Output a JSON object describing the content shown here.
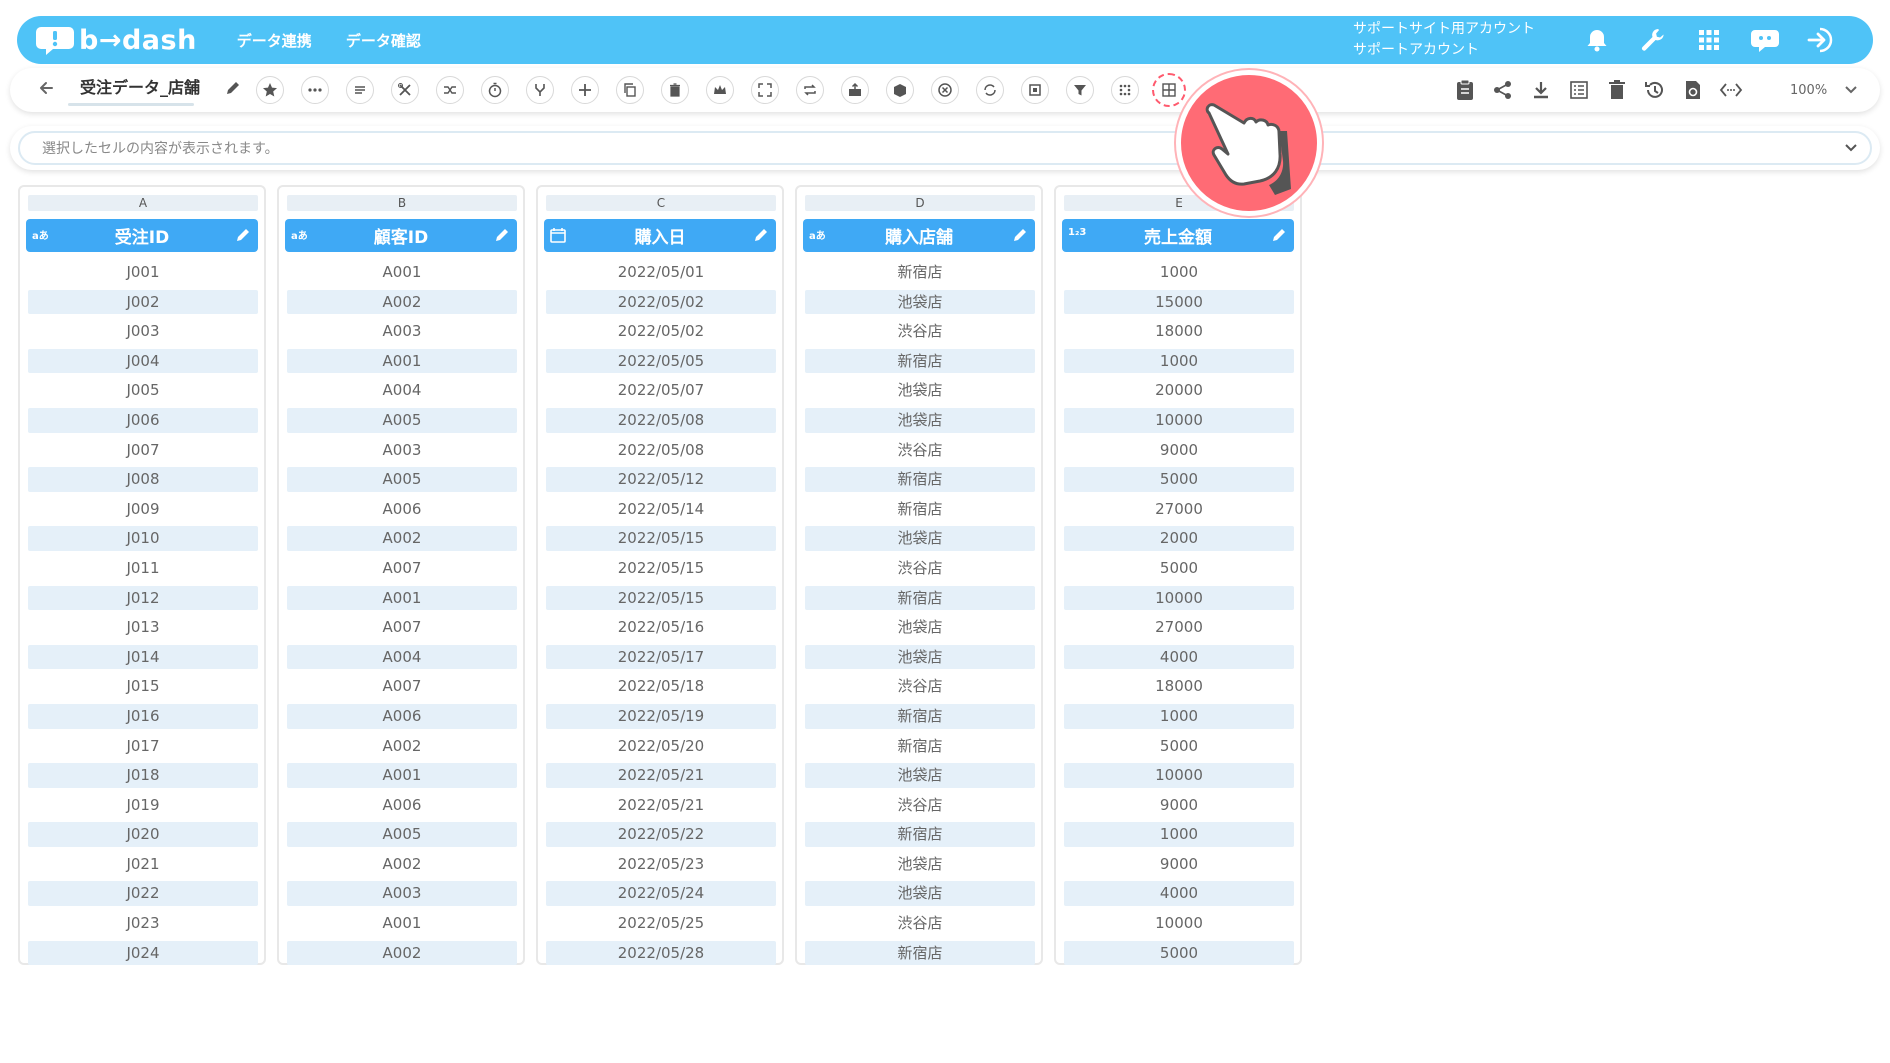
{
  "app": {
    "logo_text": "b→dash",
    "nav": [
      "データ連携",
      "データ確認"
    ],
    "account_line1": "サポートサイト用アカウント",
    "account_line2": "サポートアカウント",
    "brand_color": "#4fc3f7",
    "header_color": "#3fa9f5",
    "highlight_color": "#ff6b75"
  },
  "toolbar": {
    "title": "受注データ_店舗",
    "zoom": "100%"
  },
  "cellbar": {
    "placeholder": "選択したセルの内容が表示されます。"
  },
  "table": {
    "columns": [
      {
        "letter": "A",
        "name": "受注ID",
        "type_badge": "aあ",
        "values": [
          "J001",
          "J002",
          "J003",
          "J004",
          "J005",
          "J006",
          "J007",
          "J008",
          "J009",
          "J010",
          "J011",
          "J012",
          "J013",
          "J014",
          "J015",
          "J016",
          "J017",
          "J018",
          "J019",
          "J020",
          "J021",
          "J022",
          "J023",
          "J024"
        ]
      },
      {
        "letter": "B",
        "name": "顧客ID",
        "type_badge": "aあ",
        "values": [
          "A001",
          "A002",
          "A003",
          "A001",
          "A004",
          "A005",
          "A003",
          "A005",
          "A006",
          "A002",
          "A007",
          "A001",
          "A007",
          "A004",
          "A007",
          "A006",
          "A002",
          "A001",
          "A006",
          "A005",
          "A002",
          "A003",
          "A001",
          "A002"
        ]
      },
      {
        "letter": "C",
        "name": "購入日",
        "type_badge": "calendar",
        "values": [
          "2022/05/01",
          "2022/05/02",
          "2022/05/02",
          "2022/05/05",
          "2022/05/07",
          "2022/05/08",
          "2022/05/08",
          "2022/05/12",
          "2022/05/14",
          "2022/05/15",
          "2022/05/15",
          "2022/05/15",
          "2022/05/16",
          "2022/05/17",
          "2022/05/18",
          "2022/05/19",
          "2022/05/20",
          "2022/05/21",
          "2022/05/21",
          "2022/05/22",
          "2022/05/23",
          "2022/05/24",
          "2022/05/25",
          "2022/05/28"
        ]
      },
      {
        "letter": "D",
        "name": "購入店舗",
        "type_badge": "aあ",
        "values": [
          "新宿店",
          "池袋店",
          "渋谷店",
          "新宿店",
          "池袋店",
          "池袋店",
          "渋谷店",
          "新宿店",
          "新宿店",
          "池袋店",
          "渋谷店",
          "新宿店",
          "池袋店",
          "池袋店",
          "渋谷店",
          "新宿店",
          "新宿店",
          "池袋店",
          "渋谷店",
          "新宿店",
          "池袋店",
          "池袋店",
          "渋谷店",
          "新宿店"
        ]
      },
      {
        "letter": "E",
        "name": "売上金額",
        "type_badge": "1₂3",
        "values": [
          "1000",
          "15000",
          "18000",
          "1000",
          "20000",
          "10000",
          "9000",
          "5000",
          "27000",
          "2000",
          "5000",
          "10000",
          "27000",
          "4000",
          "18000",
          "1000",
          "5000",
          "10000",
          "9000",
          "1000",
          "9000",
          "4000",
          "10000",
          "5000"
        ]
      }
    ]
  }
}
